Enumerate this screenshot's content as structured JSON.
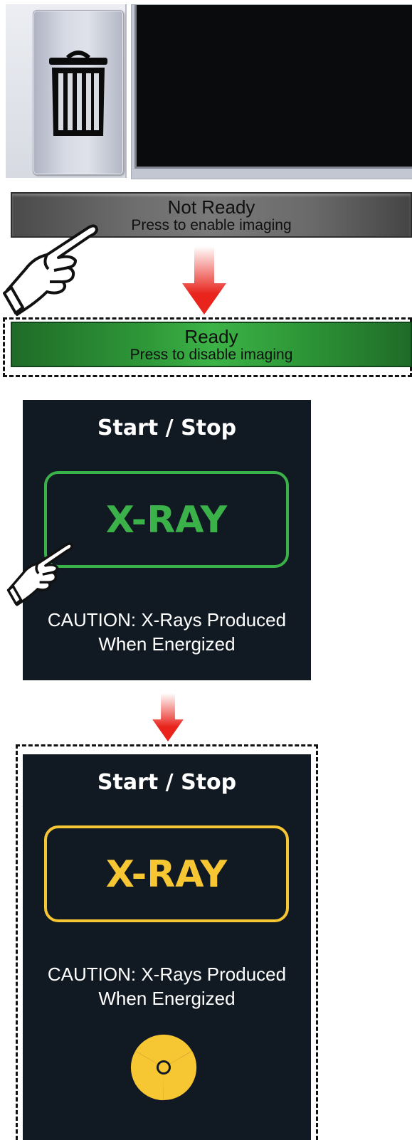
{
  "not_ready_button": {
    "title": "Not Ready",
    "subtitle": "Press to enable imaging"
  },
  "ready_button": {
    "title": "Ready",
    "subtitle": "Press to disable imaging"
  },
  "xray_panel_idle": {
    "title": "Start / Stop",
    "button_label": "X-RAY",
    "caution_line1": "CAUTION: X-Rays Produced",
    "caution_line2": "When Energized"
  },
  "xray_panel_active": {
    "title": "Start / Stop",
    "button_label": "X-RAY",
    "caution_line1": "CAUTION: X-Rays Produced",
    "caution_line2": "When Energized"
  },
  "icons": [
    "trash-icon",
    "pointing-hand-icon",
    "down-arrow-icon",
    "radiation-icon"
  ],
  "colors": {
    "panel_bg": "#111922",
    "xray_idle": "#3bb149",
    "xray_active": "#f6c633",
    "arrow": "#e8241c",
    "ready_green": "#2f9a39",
    "not_ready_gray": "#6d6d6d"
  }
}
